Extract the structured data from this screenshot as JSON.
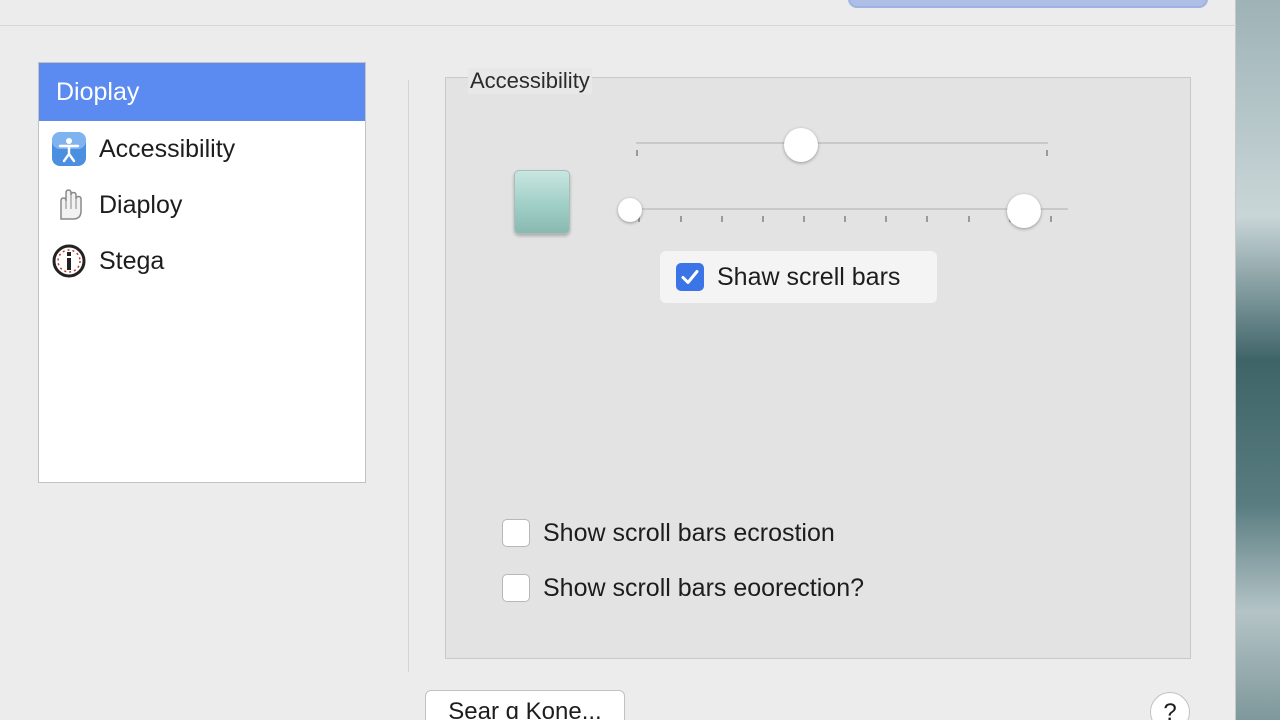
{
  "sidebar": {
    "items": [
      {
        "label": "Dioplay",
        "icon": "none",
        "selected": true
      },
      {
        "label": "Accessibility",
        "icon": "accessibility-icon",
        "selected": false
      },
      {
        "label": "Diaploy",
        "icon": "hand-icon",
        "selected": false
      },
      {
        "label": "Stega",
        "icon": "info-icon",
        "selected": false
      }
    ]
  },
  "group": {
    "title": "Accessibility"
  },
  "sliders": {
    "top": {
      "value": 0.4
    },
    "bottom": {
      "value": 0.9
    }
  },
  "options": {
    "show_scroll_bars": {
      "label": "Shaw screll bars",
      "checked": true
    },
    "option_1": {
      "label": "Show scroll bars ecrostion",
      "checked": false
    },
    "option_2": {
      "label": "Show scroll bars eoorection?",
      "checked": false
    }
  },
  "footer": {
    "button_label": "Sear ɑ Kone...",
    "help_label": "?"
  },
  "colors": {
    "accent": "#5b8af0",
    "checkbox_checked": "#3b74e6"
  }
}
